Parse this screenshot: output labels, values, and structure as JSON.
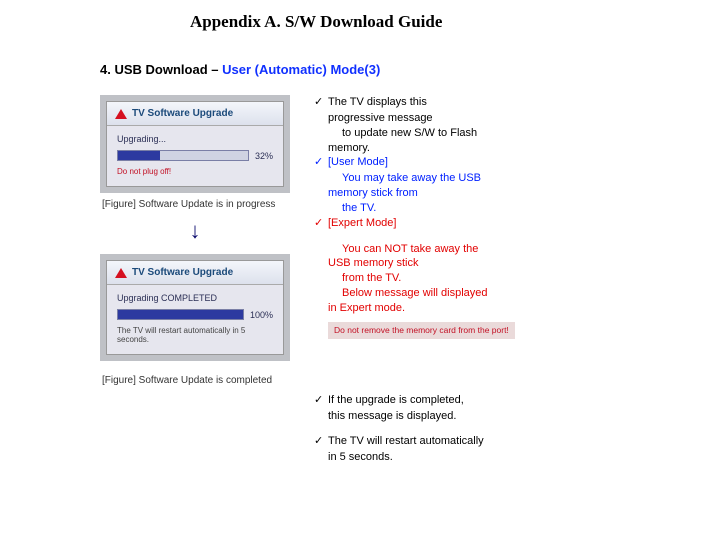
{
  "appendix_title": "Appendix A. S/W Download Guide",
  "section": {
    "num": "4.",
    "label": "USB Download – ",
    "mode": "User (Automatic) Mode(3)"
  },
  "tv1": {
    "title": "TV Software Upgrade",
    "status": "Upgrading...",
    "percent": "32%",
    "percent_width": "32%",
    "warning": "Do not plug off!",
    "caption": "[Figure] Software Update is in progress"
  },
  "arrow": "↓",
  "tv2": {
    "title": "TV Software Upgrade",
    "status": "Upgrading COMPLETED",
    "percent": "100%",
    "percent_width": "100%",
    "note": "The TV will restart automatically in 5 seconds.",
    "caption": "[Figure] Software Update is completed"
  },
  "notes": {
    "check": "✓",
    "n1a": "The TV displays this",
    "n1b": "progressive message",
    "n1c": "to update new S/W to Flash",
    "n1d": "memory.",
    "n2a": "[User Mode]",
    "n2b": "You may take away the USB",
    "n2c": "memory stick from",
    "n2d": "the TV.",
    "n3a": "[Expert Mode]",
    "n3b": "You can NOT take away the",
    "n3c": "USB memory stick",
    "n3d": "from the TV.",
    "n3e": "Below message will displayed",
    "n3f": "in Expert mode.",
    "banner": "Do not remove the memory card from the port!",
    "n4a": "If the upgrade is completed,",
    "n4b": "this message is displayed.",
    "n5a": "The TV will restart automatically",
    "n5b": "in 5 seconds."
  }
}
